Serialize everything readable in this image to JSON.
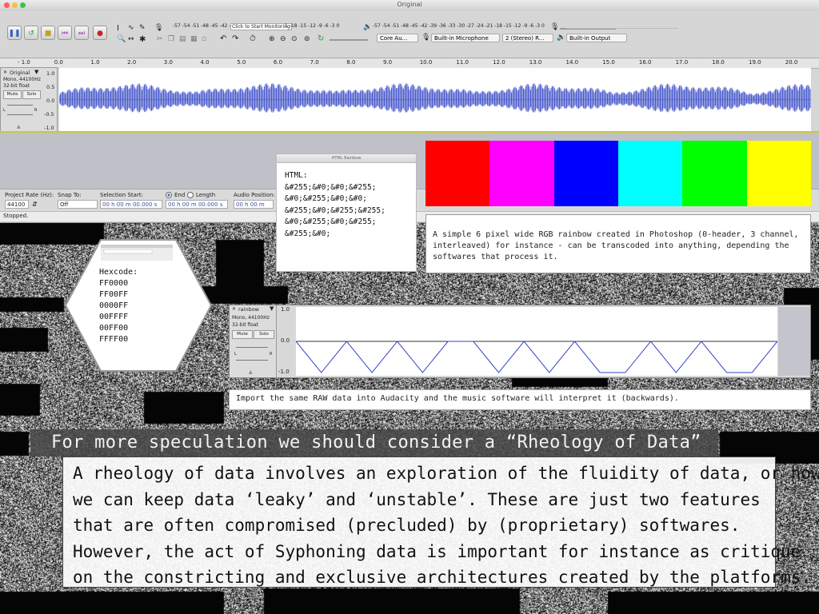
{
  "window": {
    "title": "Original"
  },
  "meters": {
    "record_scale": "-57 -54 -51 -48 -45 -42 -",
    "monitor_label": "Click to Start Monitoring",
    "record_scale2": "1 -18 -15 -12 -9 -6 -3 0",
    "play_scale": "-57 -54 -51 -48 -45 -42 -39 -36 -33 -30 -27 -24 -21 -18 -15 -12 -9 -6 -3 0"
  },
  "devices": {
    "host": "Core Au...",
    "input": "Built-in Microphone",
    "channels": "2 (Stereo) R...",
    "output": "Built-in Output"
  },
  "ruler": [
    "- 1.0",
    "0.0",
    "1.0",
    "2.0",
    "3.0",
    "4.0",
    "5.0",
    "6.0",
    "7.0",
    "8.0",
    "9.0",
    "10.0",
    "11.0",
    "12.0",
    "13.0",
    "14.0",
    "15.0",
    "16.0",
    "17.0",
    "18.0",
    "19.0",
    "20.0"
  ],
  "track": {
    "name": "Original",
    "info1": "Mono, 44100Hz",
    "info2": "32-bit float",
    "mute": "Mute",
    "solo": "Solo",
    "l": "L",
    "r": "R",
    "scale": [
      "1.0",
      "0.5",
      "0.0",
      "-0.5",
      "-1.0"
    ]
  },
  "selectionbar": {
    "rate_label": "Project Rate (Hz):",
    "rate": "44100",
    "snap_label": "Snap To:",
    "snap": "Off",
    "sel_start_label": "Selection Start:",
    "end_label": "End",
    "length_label": "Length",
    "audio_pos_label": "Audio Position:",
    "time1": "00 h 00 m 00.000 s",
    "time2": "00 h 00 m 00.000 s",
    "time3": "00 h 00 m 00.",
    "status": "Stopped."
  },
  "html_panel": {
    "title": "HTML Rainbow",
    "heading": "HTML:",
    "lines": [
      "&#255;&#0;&#0;&#255;",
      "&#0;&#255;&#0;&#0;",
      "&#255;&#0;&#255;&#255;",
      "&#0;&#255;&#0;&#255;",
      "&#255;&#0;"
    ]
  },
  "rainbow_colors": [
    "#ff0000",
    "#ff00ff",
    "#0000ff",
    "#00ffff",
    "#00ff00",
    "#ffff00"
  ],
  "desc1": "A simple 6 pixel wide RGB rainbow created in Photoshop (0-header, 3 channel, interleaved) for instance - can be transcoded into anything, depending the softwares that process it.",
  "hexcode": {
    "heading": "Hexcode:",
    "values": [
      "FF0000",
      "FF00FF",
      "0000FF",
      "00FFFF",
      "00FF00",
      "FFFF00"
    ]
  },
  "track2": {
    "name": "rainbow",
    "info1": "Mono, 44100Hz",
    "info2": "32-bit float",
    "mute": "Mute",
    "solo": "Solo",
    "l": "L",
    "r": "R",
    "scale": [
      "1.0",
      "0.0",
      "-1.0"
    ],
    "values": [
      0,
      -1,
      0,
      -1,
      0,
      -1,
      0,
      0,
      -1,
      0,
      -1,
      0,
      -1,
      -1,
      0,
      -1,
      0,
      -1,
      -1,
      0
    ]
  },
  "desc2": "Import the same RAW data into Audacity and the music software will interpret it (backwards).",
  "heading": "For more speculation we should consider a “Rheology of Data”",
  "paragraph": [
    "A rheology of data involves an exploration of the fluidity of data, or how",
    "we can keep data ‘leaky’ and ‘unstable’. These are just two features",
    "that are often compromised (precluded) by (proprietary) softwares.",
    "However, the act of Syphoning data is important for instance as critique",
    "on the constricting and exclusive architectures created by the platforms."
  ]
}
